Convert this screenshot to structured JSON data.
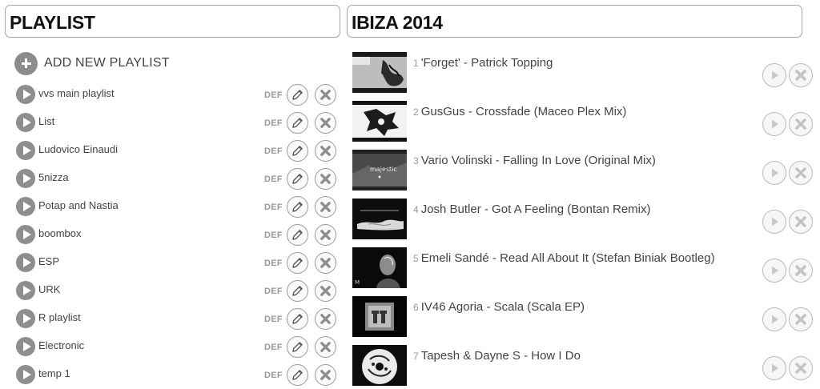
{
  "left_panel": {
    "title": "PLAYLIST",
    "add_label": "ADD NEW PLAYLIST",
    "def_label": "DEF",
    "playlists": [
      {
        "name": "vvs main playlist"
      },
      {
        "name": "List"
      },
      {
        "name": "Ludovico Einaudi"
      },
      {
        "name": "5nizza"
      },
      {
        "name": "Potap and Nastia"
      },
      {
        "name": "boombox"
      },
      {
        "name": "ESP"
      },
      {
        "name": "URK"
      },
      {
        "name": "R playlist"
      },
      {
        "name": "Electronic"
      },
      {
        "name": "temp 1"
      }
    ]
  },
  "right_panel": {
    "title": "IBIZA 2014",
    "tracks": [
      {
        "num": "1",
        "title": "'Forget' - Patrick Topping"
      },
      {
        "num": "2",
        "title": "GusGus - Crossfade (Maceo Plex Mix)"
      },
      {
        "num": "3",
        "title": "Vario Volinski - Falling In Love (Original Mix)",
        "thumb_text": "majestic"
      },
      {
        "num": "4",
        "title": "Josh Butler - Got A Feeling (Bontan Remix)"
      },
      {
        "num": "5",
        "title": "Emeli Sandé - Read All About It (Stefan Biniak Bootleg)"
      },
      {
        "num": "6",
        "title": "IV46 Agoria - Scala (Scala EP)"
      },
      {
        "num": "7",
        "title": "Tapesh & Dayne S - How I Do"
      }
    ]
  },
  "icons": {
    "play": "play-icon",
    "edit": "pencil-icon",
    "delete": "close-icon",
    "add": "plus-icon"
  }
}
